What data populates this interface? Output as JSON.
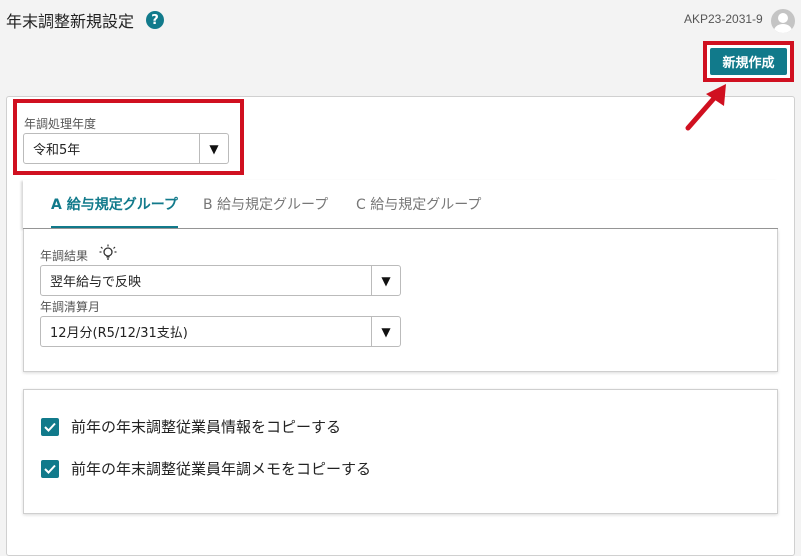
{
  "header": {
    "title": "年末調整新規設定",
    "help_icon_label": "?",
    "company_code": "AKP23-2031-9",
    "new_button_label": "新規作成"
  },
  "year_field": {
    "label": "年調処理年度",
    "value": "令和5年"
  },
  "tabs": [
    {
      "label": "A 給与規定グループ",
      "active": true
    },
    {
      "label": "B 給与規定グループ",
      "active": false
    },
    {
      "label": "C 給与規定グループ",
      "active": false
    }
  ],
  "settings": {
    "result_label": "年調結果",
    "result_value": "翌年給与で反映",
    "month_label": "年調清算月",
    "month_value": "12月分(R5/12/31支払)"
  },
  "copy_options": [
    {
      "label": "前年の年末調整従業員情報をコピーする",
      "checked": true
    },
    {
      "label": "前年の年末調整従業員年調メモをコピーする",
      "checked": true
    }
  ],
  "dropdown_glyph": "▼",
  "colors": {
    "accent": "#117a8b",
    "highlight_frame": "#d01020"
  }
}
